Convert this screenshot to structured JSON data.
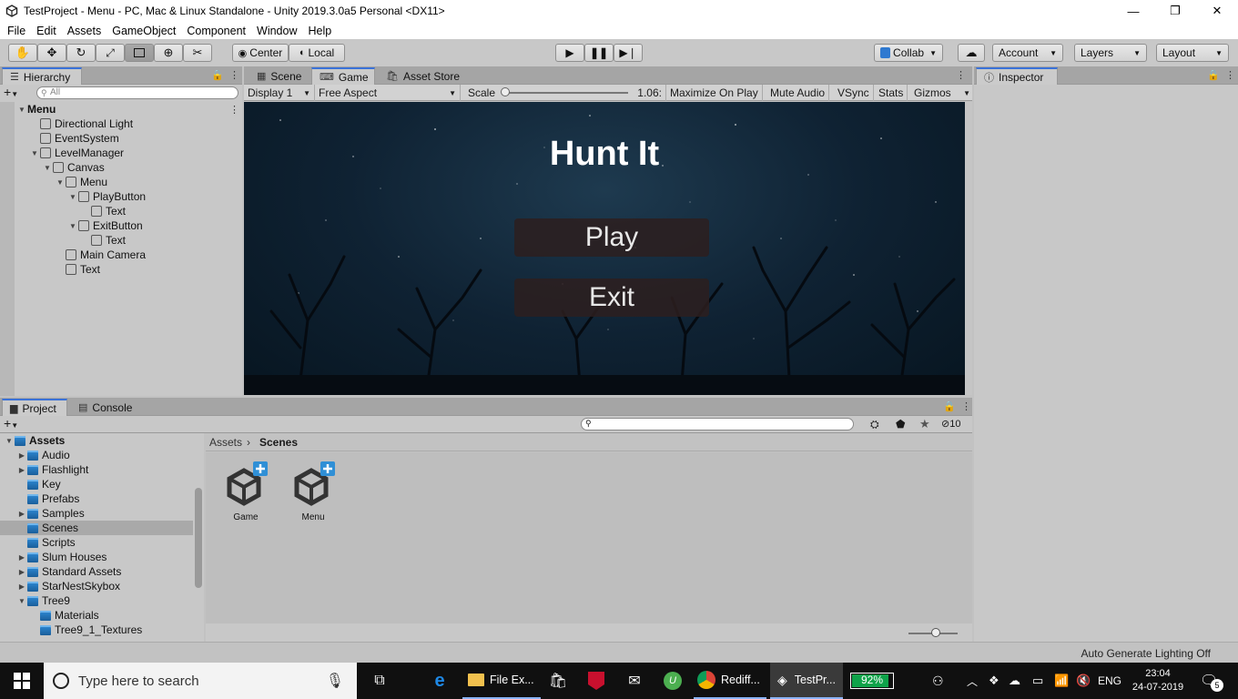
{
  "window": {
    "title": "TestProject - Menu - PC, Mac & Linux Standalone - Unity 2019.3.0a5 Personal <DX11>",
    "minimize": "—",
    "maximize": "❐",
    "close": "✕"
  },
  "menubar": [
    "File",
    "Edit",
    "Assets",
    "GameObject",
    "Component",
    "Window",
    "Help"
  ],
  "toolbar": {
    "tools": [
      "hand-icon",
      "move-icon",
      "rotate-icon",
      "scale-icon",
      "rect-icon",
      "transform-icon",
      "custom-tool-icon"
    ],
    "pivot": "Center",
    "space": "Local",
    "collab": "Collab",
    "account": "Account",
    "layers": "Layers",
    "layout": "Layout"
  },
  "hierarchy": {
    "tab": "Hierarchy",
    "search_placeholder": "All",
    "items": [
      {
        "label": "Menu",
        "depth": 0,
        "arrow": "▼",
        "bold": true
      },
      {
        "label": "Directional Light",
        "depth": 1,
        "arrow": ""
      },
      {
        "label": "EventSystem",
        "depth": 1,
        "arrow": ""
      },
      {
        "label": "LevelManager",
        "depth": 1,
        "arrow": "▼"
      },
      {
        "label": "Canvas",
        "depth": 2,
        "arrow": "▼"
      },
      {
        "label": "Menu",
        "depth": 3,
        "arrow": "▼"
      },
      {
        "label": "PlayButton",
        "depth": 4,
        "arrow": "▼"
      },
      {
        "label": "Text",
        "depth": 5,
        "arrow": ""
      },
      {
        "label": "ExitButton",
        "depth": 4,
        "arrow": "▼"
      },
      {
        "label": "Text",
        "depth": 5,
        "arrow": ""
      },
      {
        "label": "Main Camera",
        "depth": 3,
        "arrow": ""
      },
      {
        "label": "Text",
        "depth": 3,
        "arrow": ""
      }
    ]
  },
  "center_tabs": {
    "scene": "Scene",
    "game": "Game",
    "asset_store": "Asset Store"
  },
  "game_bar": {
    "display": "Display 1",
    "aspect": "Free Aspect",
    "scale_label": "Scale",
    "scale_value": 1.06,
    "scale_text": "1.06:",
    "maximize": "Maximize On Play",
    "mute": "Mute Audio",
    "vsync": "VSync",
    "stats": "Stats",
    "gizmos": "Gizmos"
  },
  "game": {
    "title": "Hunt It",
    "play": "Play",
    "exit": "Exit"
  },
  "inspector": {
    "tab": "Inspector"
  },
  "project": {
    "tab_project": "Project",
    "tab_console": "Console",
    "hidden_count": "10",
    "breadcrumb_root": "Assets",
    "breadcrumb_current": "Scenes",
    "tree": [
      {
        "label": "Assets",
        "depth": 0,
        "arrow": "▼",
        "bold": true
      },
      {
        "label": "Audio",
        "depth": 1,
        "arrow": "▶"
      },
      {
        "label": "Flashlight",
        "depth": 1,
        "arrow": "▶"
      },
      {
        "label": "Key",
        "depth": 1,
        "arrow": ""
      },
      {
        "label": "Prefabs",
        "depth": 1,
        "arrow": ""
      },
      {
        "label": "Samples",
        "depth": 1,
        "arrow": "▶"
      },
      {
        "label": "Scenes",
        "depth": 1,
        "arrow": "",
        "selected": true
      },
      {
        "label": "Scripts",
        "depth": 1,
        "arrow": ""
      },
      {
        "label": "Slum Houses",
        "depth": 1,
        "arrow": "▶"
      },
      {
        "label": "Standard Assets",
        "depth": 1,
        "arrow": "▶"
      },
      {
        "label": "StarNestSkybox",
        "depth": 1,
        "arrow": "▶"
      },
      {
        "label": "Tree9",
        "depth": 1,
        "arrow": "▼"
      },
      {
        "label": "Materials",
        "depth": 2,
        "arrow": ""
      },
      {
        "label": "Tree9_1_Textures",
        "depth": 2,
        "arrow": ""
      }
    ],
    "files": [
      "Game",
      "Menu"
    ]
  },
  "status": {
    "message": "Auto Generate Lighting Off"
  },
  "taskbar": {
    "search_placeholder": "Type here to search",
    "apps": [
      {
        "label": "File Ex...",
        "icon": "folder-icon"
      },
      {
        "label": "Rediff...",
        "icon": "chrome-icon"
      },
      {
        "label": "TestPr...",
        "icon": "unity-icon",
        "active": true
      }
    ],
    "battery": "92%",
    "battery_level": 0.92,
    "lang": "ENG",
    "time": "23:04",
    "date": "24-07-2019",
    "notifications": "5"
  },
  "colors": {
    "accent_tab": "#3a72d8",
    "battery_fill": "#0fa34a",
    "mcafee": "#c8102e",
    "chrome_red": "#db4437"
  }
}
